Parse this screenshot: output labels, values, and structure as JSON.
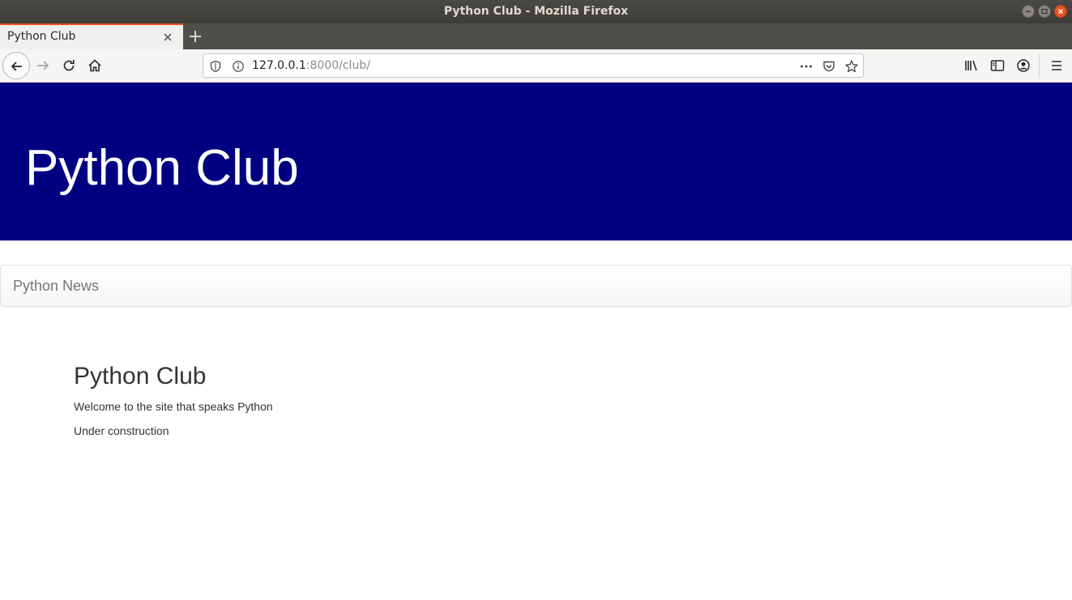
{
  "window": {
    "title": "Python Club - Mozilla Firefox"
  },
  "tabs": [
    {
      "label": "Python Club",
      "active": true
    }
  ],
  "toolbar": {
    "url_host": "127.0.0.1",
    "url_rest": ":8000/club/"
  },
  "page": {
    "jumbotron_title": "Python Club",
    "nav_brand": "Python News",
    "heading": "Python Club",
    "welcome_text": "Welcome to the site that speaks Python",
    "status_text": "Under construction"
  },
  "colors": {
    "jumbotron_bg": "#000080",
    "accent": "#e95420"
  }
}
